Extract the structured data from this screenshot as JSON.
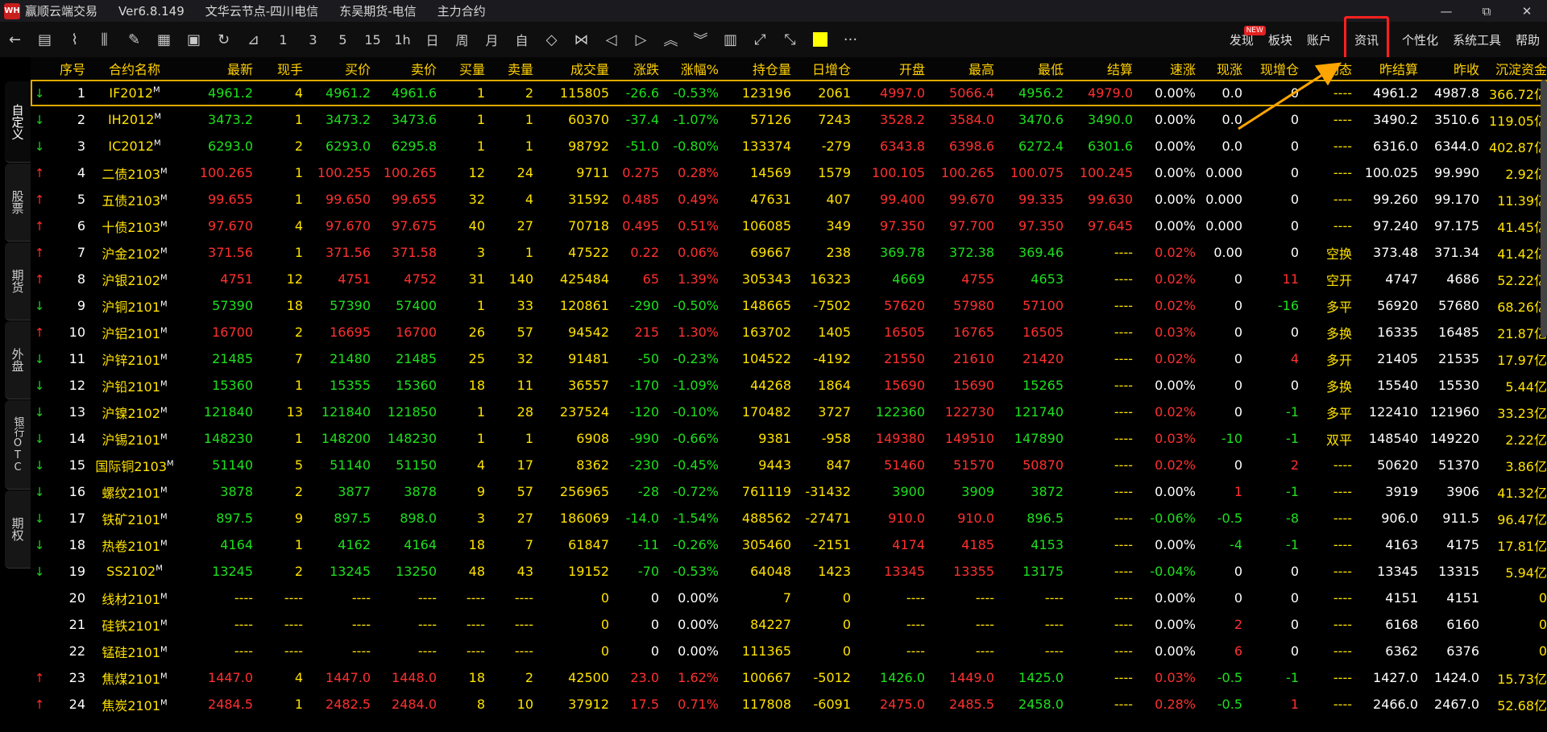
{
  "window": {
    "logo": "WH",
    "segments": [
      "赢顺云端交易",
      "Ver6.8.149",
      "文华云节点-四川电信",
      "东吴期货-电信",
      "主力合约"
    ],
    "controls": [
      "—",
      "⧉",
      "✕"
    ]
  },
  "toolbar": {
    "icons": [
      "←",
      "▤",
      "⌇",
      "⫼",
      "✎",
      "▦",
      "▣",
      "↻",
      "⊿"
    ],
    "periods": [
      "1",
      "3",
      "5",
      "15",
      "1h",
      "日",
      "周",
      "月",
      "自"
    ],
    "nav_icons": [
      "◇",
      "⋈",
      "◁",
      "▷",
      "︽",
      "︾",
      "▥",
      "⤢",
      "⤡"
    ],
    "more": "···"
  },
  "menu": [
    {
      "label": "发现",
      "badge": "NEW"
    },
    {
      "label": "板块"
    },
    {
      "label": "账户"
    },
    {
      "label": "资讯",
      "highlight": true
    },
    {
      "label": "个性化"
    },
    {
      "label": "系统工具"
    },
    {
      "label": "帮助"
    }
  ],
  "left_tabs": [
    "自定义",
    "股票",
    "期货",
    "外盘",
    "银行OTC",
    "期权"
  ],
  "headers": [
    "序号",
    "合约名称",
    "最新",
    "现手",
    "买价",
    "卖价",
    "买量",
    "卖量",
    "成交量",
    "涨跌",
    "涨幅%",
    "持仓量",
    "日增仓",
    "开盘",
    "最高",
    "最低",
    "结算",
    "速涨",
    "现涨",
    "现增仓",
    "动态",
    "昨结算",
    "昨收",
    "沉淀资金"
  ],
  "accent": {
    "highlight": "#ff2020",
    "arrow": "#ffa500",
    "selected": "#e0a800"
  },
  "rows": [
    {
      "arrow": "dn",
      "cells": [
        "1",
        "IF2012",
        "4961.2",
        "4",
        "4961.2",
        "4961.6",
        "1",
        "2",
        "115805",
        "-26.6",
        "-0.53%",
        "123196",
        "2061",
        "4997.0",
        "5066.4",
        "4956.2",
        "4979.0",
        "0.00%",
        "0.0",
        "0",
        "----",
        "4961.2",
        "4987.8",
        "366.72亿"
      ],
      "colors": "wwgyggyyygggywrrggwwwywwy"
    },
    {
      "arrow": "dn",
      "cells": [
        "2",
        "IH2012",
        "3473.2",
        "1",
        "3473.2",
        "3473.6",
        "1",
        "1",
        "60370",
        "-37.4",
        "-1.07%",
        "57126",
        "7243",
        "3528.2",
        "3584.0",
        "3470.6",
        "3490.0",
        "0.00%",
        "0.0",
        "0",
        "----",
        "3490.2",
        "3510.6",
        "119.05亿"
      ]
    },
    {
      "arrow": "dn",
      "cells": [
        "3",
        "IC2012",
        "6293.0",
        "2",
        "6293.0",
        "6295.8",
        "1",
        "1",
        "98792",
        "-51.0",
        "-0.80%",
        "133374",
        "-279",
        "6343.8",
        "6398.6",
        "6272.4",
        "6301.6",
        "0.00%",
        "0.0",
        "0",
        "----",
        "6316.0",
        "6344.0",
        "402.87亿"
      ]
    },
    {
      "arrow": "up",
      "cells": [
        "4",
        "二债2103",
        "100.265",
        "1",
        "100.255",
        "100.265",
        "12",
        "24",
        "9711",
        "0.275",
        "0.28%",
        "14569",
        "1579",
        "100.105",
        "100.265",
        "100.075",
        "100.245",
        "0.00%",
        "0.000",
        "0",
        "----",
        "100.025",
        "99.990",
        "2.92亿"
      ]
    },
    {
      "arrow": "up",
      "cells": [
        "5",
        "五债2103",
        "99.655",
        "1",
        "99.650",
        "99.655",
        "32",
        "4",
        "31592",
        "0.485",
        "0.49%",
        "47631",
        "407",
        "99.400",
        "99.670",
        "99.335",
        "99.630",
        "0.00%",
        "0.000",
        "0",
        "----",
        "99.260",
        "99.170",
        "11.39亿"
      ]
    },
    {
      "arrow": "up",
      "cells": [
        "6",
        "十债2103",
        "97.670",
        "4",
        "97.670",
        "97.675",
        "40",
        "27",
        "70718",
        "0.495",
        "0.51%",
        "106085",
        "349",
        "97.350",
        "97.700",
        "97.350",
        "97.645",
        "0.00%",
        "0.000",
        "0",
        "----",
        "97.240",
        "97.175",
        "41.45亿"
      ]
    },
    {
      "arrow": "up",
      "cells": [
        "7",
        "沪金2102",
        "371.56",
        "1",
        "371.56",
        "371.58",
        "3",
        "1",
        "47522",
        "0.22",
        "0.06%",
        "69667",
        "238",
        "369.78",
        "372.38",
        "369.46",
        "----",
        "0.02%",
        "0.00",
        "0",
        "空换",
        "373.48",
        "371.34",
        "41.42亿"
      ]
    },
    {
      "arrow": "up",
      "cells": [
        "8",
        "沪银2102",
        "4751",
        "12",
        "4751",
        "4752",
        "31",
        "140",
        "425484",
        "65",
        "1.39%",
        "305343",
        "16323",
        "4669",
        "4755",
        "4653",
        "----",
        "0.02%",
        "0",
        "11",
        "空开",
        "4747",
        "4686",
        "52.22亿"
      ]
    },
    {
      "arrow": "dn",
      "cells": [
        "9",
        "沪铜2101",
        "57390",
        "18",
        "57390",
        "57400",
        "1",
        "33",
        "120861",
        "-290",
        "-0.50%",
        "148665",
        "-7502",
        "57620",
        "57980",
        "57100",
        "----",
        "0.02%",
        "0",
        "-16",
        "多平",
        "56920",
        "57680",
        "68.26亿"
      ]
    },
    {
      "arrow": "up",
      "cells": [
        "10",
        "沪铝2101",
        "16700",
        "2",
        "16695",
        "16700",
        "26",
        "57",
        "94542",
        "215",
        "1.30%",
        "163702",
        "1405",
        "16505",
        "16765",
        "16505",
        "----",
        "0.03%",
        "0",
        "0",
        "多换",
        "16335",
        "16485",
        "21.87亿"
      ]
    },
    {
      "arrow": "dn",
      "cells": [
        "11",
        "沪锌2101",
        "21485",
        "7",
        "21480",
        "21485",
        "25",
        "32",
        "91481",
        "-50",
        "-0.23%",
        "104522",
        "-4192",
        "21550",
        "21610",
        "21420",
        "----",
        "0.02%",
        "0",
        "4",
        "多开",
        "21405",
        "21535",
        "17.97亿"
      ]
    },
    {
      "arrow": "dn",
      "cells": [
        "12",
        "沪铅2101",
        "15360",
        "1",
        "15355",
        "15360",
        "18",
        "11",
        "36557",
        "-170",
        "-1.09%",
        "44268",
        "1864",
        "15690",
        "15690",
        "15265",
        "----",
        "0.00%",
        "0",
        "0",
        "多换",
        "15540",
        "15530",
        "5.44亿"
      ]
    },
    {
      "arrow": "dn",
      "cells": [
        "13",
        "沪镍2102",
        "121840",
        "13",
        "121840",
        "121850",
        "1",
        "28",
        "237524",
        "-120",
        "-0.10%",
        "170482",
        "3727",
        "122360",
        "122730",
        "121740",
        "----",
        "0.02%",
        "0",
        "-1",
        "多平",
        "122410",
        "121960",
        "33.23亿"
      ]
    },
    {
      "arrow": "dn",
      "cells": [
        "14",
        "沪锡2101",
        "148230",
        "1",
        "148200",
        "148230",
        "1",
        "1",
        "6908",
        "-990",
        "-0.66%",
        "9381",
        "-958",
        "149380",
        "149510",
        "147890",
        "----",
        "0.03%",
        "-10",
        "-1",
        "双平",
        "148540",
        "149220",
        "2.22亿"
      ]
    },
    {
      "arrow": "dn",
      "cells": [
        "15",
        "国际铜2103",
        "51140",
        "5",
        "51140",
        "51150",
        "4",
        "17",
        "8362",
        "-230",
        "-0.45%",
        "9443",
        "847",
        "51460",
        "51570",
        "50870",
        "----",
        "0.02%",
        "0",
        "2",
        "----",
        "50620",
        "51370",
        "3.86亿"
      ]
    },
    {
      "arrow": "dn",
      "cells": [
        "16",
        "螺纹2101",
        "3878",
        "2",
        "3877",
        "3878",
        "9",
        "57",
        "256965",
        "-28",
        "-0.72%",
        "761119",
        "-31432",
        "3900",
        "3909",
        "3872",
        "----",
        "0.00%",
        "1",
        "-1",
        "----",
        "3919",
        "3906",
        "41.32亿"
      ]
    },
    {
      "arrow": "dn",
      "cells": [
        "17",
        "铁矿2101",
        "897.5",
        "9",
        "897.5",
        "898.0",
        "3",
        "27",
        "186069",
        "-14.0",
        "-1.54%",
        "488562",
        "-27471",
        "910.0",
        "910.0",
        "896.5",
        "----",
        "-0.06%",
        "-0.5",
        "-8",
        "----",
        "906.0",
        "911.5",
        "96.47亿"
      ]
    },
    {
      "arrow": "dn",
      "cells": [
        "18",
        "热卷2101",
        "4164",
        "1",
        "4162",
        "4164",
        "18",
        "7",
        "61847",
        "-11",
        "-0.26%",
        "305460",
        "-2151",
        "4174",
        "4185",
        "4153",
        "----",
        "0.00%",
        "-4",
        "-1",
        "----",
        "4163",
        "4175",
        "17.81亿"
      ]
    },
    {
      "arrow": "dn",
      "cells": [
        "19",
        "SS2102",
        "13245",
        "2",
        "13245",
        "13250",
        "48",
        "43",
        "19152",
        "-70",
        "-0.53%",
        "64048",
        "1423",
        "13345",
        "13355",
        "13175",
        "----",
        "-0.04%",
        "0",
        "0",
        "----",
        "13345",
        "13315",
        "5.94亿"
      ]
    },
    {
      "arrow": "",
      "cells": [
        "20",
        "线材2101",
        "----",
        "----",
        "----",
        "----",
        "----",
        "----",
        "0",
        "0",
        "0.00%",
        "7",
        "0",
        "----",
        "----",
        "----",
        "----",
        "0.00%",
        "0",
        "0",
        "----",
        "4151",
        "4151",
        "0"
      ]
    },
    {
      "arrow": "",
      "cells": [
        "21",
        "硅铁2101",
        "----",
        "----",
        "----",
        "----",
        "----",
        "----",
        "0",
        "0",
        "0.00%",
        "84227",
        "0",
        "----",
        "----",
        "----",
        "----",
        "0.00%",
        "2",
        "0",
        "----",
        "6168",
        "6160",
        "0"
      ]
    },
    {
      "arrow": "",
      "cells": [
        "22",
        "锰硅2101",
        "----",
        "----",
        "----",
        "----",
        "----",
        "----",
        "0",
        "0",
        "0.00%",
        "111365",
        "0",
        "----",
        "----",
        "----",
        "----",
        "0.00%",
        "6",
        "0",
        "----",
        "6362",
        "6376",
        "0"
      ]
    },
    {
      "arrow": "up",
      "cells": [
        "23",
        "焦煤2101",
        "1447.0",
        "4",
        "1447.0",
        "1448.0",
        "18",
        "2",
        "42500",
        "23.0",
        "1.62%",
        "100667",
        "-5012",
        "1426.0",
        "1449.0",
        "1425.0",
        "----",
        "0.03%",
        "-0.5",
        "-1",
        "----",
        "1427.0",
        "1424.0",
        "15.73亿"
      ]
    },
    {
      "arrow": "up",
      "cells": [
        "24",
        "焦炭2101",
        "2484.5",
        "1",
        "2482.5",
        "2484.0",
        "8",
        "10",
        "37912",
        "17.5",
        "0.71%",
        "117808",
        "-6091",
        "2475.0",
        "2485.5",
        "2458.0",
        "----",
        "0.28%",
        "-0.5",
        "1",
        "----",
        "2466.0",
        "2467.0",
        "52.68亿"
      ]
    }
  ]
}
